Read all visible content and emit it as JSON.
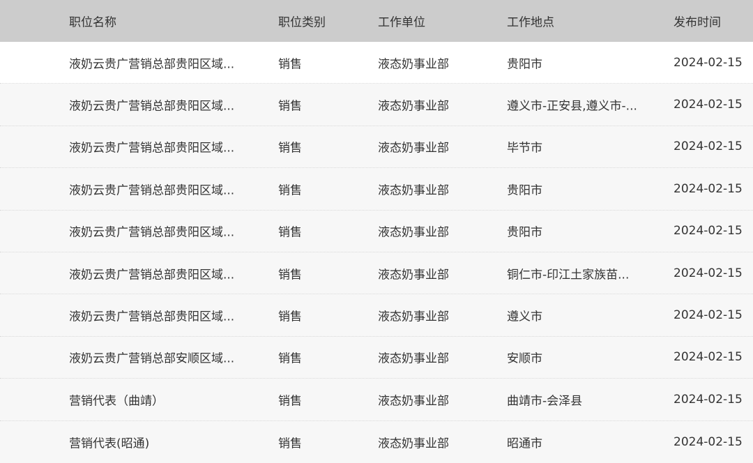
{
  "table": {
    "headers": {
      "name": "职位名称",
      "type": "职位类别",
      "unit": "工作单位",
      "location": "工作地点",
      "date": "发布时间"
    },
    "rows": [
      {
        "name": "液奶云贵广营销总部贵阳区域...",
        "type": "销售",
        "unit": "液态奶事业部",
        "location": "贵阳市",
        "date": "2024-02-15"
      },
      {
        "name": "液奶云贵广营销总部贵阳区域...",
        "type": "销售",
        "unit": "液态奶事业部",
        "location": "遵义市-正安县,遵义市-...",
        "date": "2024-02-15"
      },
      {
        "name": "液奶云贵广营销总部贵阳区域...",
        "type": "销售",
        "unit": "液态奶事业部",
        "location": "毕节市",
        "date": "2024-02-15"
      },
      {
        "name": "液奶云贵广营销总部贵阳区域...",
        "type": "销售",
        "unit": "液态奶事业部",
        "location": "贵阳市",
        "date": "2024-02-15"
      },
      {
        "name": "液奶云贵广营销总部贵阳区域...",
        "type": "销售",
        "unit": "液态奶事业部",
        "location": "贵阳市",
        "date": "2024-02-15"
      },
      {
        "name": "液奶云贵广营销总部贵阳区域...",
        "type": "销售",
        "unit": "液态奶事业部",
        "location": "铜仁市-印江土家族苗...",
        "date": "2024-02-15"
      },
      {
        "name": "液奶云贵广营销总部贵阳区域...",
        "type": "销售",
        "unit": "液态奶事业部",
        "location": "遵义市",
        "date": "2024-02-15"
      },
      {
        "name": "液奶云贵广营销总部安顺区域...",
        "type": "销售",
        "unit": "液态奶事业部",
        "location": "安顺市",
        "date": "2024-02-15"
      },
      {
        "name": "营销代表（曲靖）",
        "type": "销售",
        "unit": "液态奶事业部",
        "location": "曲靖市-会泽县",
        "date": "2024-02-15"
      },
      {
        "name": "营销代表(昭通)",
        "type": "销售",
        "unit": "液态奶事业部",
        "location": "昭通市",
        "date": "2024-02-15"
      }
    ]
  },
  "colors": {
    "header_bg": "#cccccc",
    "row_bg": "#f7f7f7",
    "first_row_bg": "#ffffff",
    "text": "#333333"
  }
}
